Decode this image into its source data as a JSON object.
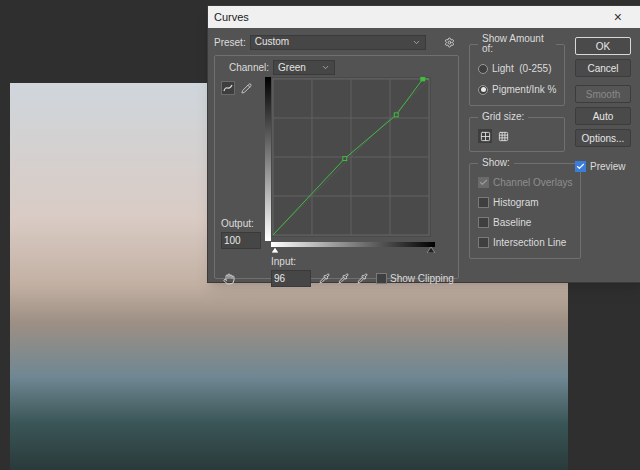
{
  "window": {
    "title": "Curves",
    "close": "×"
  },
  "preset": {
    "label": "Preset:",
    "value": "Custom"
  },
  "channel": {
    "label": "Channel:",
    "value": "Green"
  },
  "curve": {
    "points": [
      {
        "input": 0,
        "output": 0,
        "selected": false
      },
      {
        "input": 46,
        "output": 49,
        "selected": false
      },
      {
        "input": 79,
        "output": 77,
        "selected": false
      },
      {
        "input": 96,
        "output": 100,
        "selected": true
      }
    ]
  },
  "output": {
    "label": "Output:",
    "value": "100"
  },
  "input": {
    "label": "Input:",
    "value": "96"
  },
  "show_clipping": {
    "label": "Show Clipping",
    "checked": false
  },
  "show_amount": {
    "title": "Show Amount of:",
    "options": [
      {
        "label": "Light  (0-255)",
        "selected": false
      },
      {
        "label": "Pigment/Ink %",
        "selected": true
      }
    ]
  },
  "grid_size": {
    "title": "Grid size:",
    "options": [
      {
        "kind": "coarse",
        "selected": true
      },
      {
        "kind": "fine",
        "selected": false
      }
    ]
  },
  "show": {
    "title": "Show:",
    "options": [
      {
        "label": "Channel Overlays",
        "checked": true,
        "disabled": true
      },
      {
        "label": "Histogram",
        "checked": false,
        "disabled": false
      },
      {
        "label": "Baseline",
        "checked": false,
        "disabled": false
      },
      {
        "label": "Intersection Line",
        "checked": false,
        "disabled": false
      }
    ]
  },
  "buttons": [
    {
      "label": "OK",
      "disabled": false,
      "default": true
    },
    {
      "label": "Cancel",
      "disabled": false,
      "default": false
    },
    {
      "label": "Smooth",
      "disabled": true,
      "default": false
    },
    {
      "label": "Auto",
      "disabled": false,
      "default": false
    },
    {
      "label": "Options...",
      "disabled": false,
      "default": false
    }
  ],
  "preview": {
    "label": "Preview",
    "checked": true
  }
}
